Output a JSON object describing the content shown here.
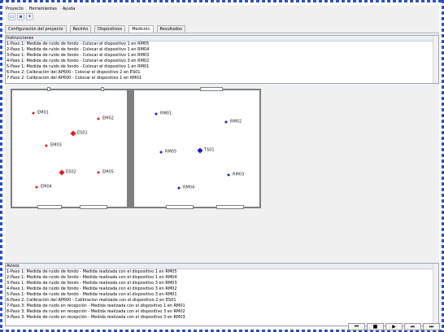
{
  "menu": [
    "Proyecto",
    "Herramientas",
    "Ayuda"
  ],
  "toolbar": {
    "icons": [
      "new-file-icon",
      "save-icon",
      "settings-icon"
    ],
    "symbols": [
      "▭",
      "▪",
      "✦"
    ]
  },
  "tabs": [
    "Configuración del proyecto",
    "Recinto",
    "Dispositivos",
    "Medición",
    "Resultados"
  ],
  "active_tab": "Medición",
  "instructions": {
    "title": "Instrucciones",
    "rows": [
      "1-Paso 1: Medida de ruido de fondo - Colocar el dispositivo 1 en RM05",
      "2-Paso 1: Medida de ruido de fondo - Colocar el dispositivo 1 en RM04",
      "3-Paso 1: Medida de ruido de fondo - Colocar el dispositivo 1 en RM03",
      "4-Paso 1: Medida de ruido de fondo - Colocar el dispositivo 3 en RM02",
      "5-Paso 1: Medida de ruido de fondo - Colocar el dispositivo 1 en RM01",
      "6-Paso 2: Calibración del AP600 - Colocar el dispositivo 2 en ES01",
      "7-Paso 2: Calibración del AP600 - Colocar el dispositivo 1 en RM01"
    ]
  },
  "floorplan": {
    "emission_points": [
      "EM01",
      "EM02",
      "ES01",
      "EM03",
      "ES02",
      "EM05",
      "EM04"
    ],
    "reception_points": [
      "RM01",
      "RM02",
      "RM05",
      "TS01",
      "RM03",
      "RM04"
    ],
    "colors": {
      "emission": "#e01b1b",
      "reception": "#1a1acf",
      "wall": "#7f7f7f"
    }
  },
  "notices": {
    "title": "Avisos",
    "rows": [
      "1-Paso 1: Medida de ruido de fondo - Medida realizada con el dispositivo 1 en RM05",
      "2-Paso 1: Medida de ruido de fondo - Medida realizada con el dispositivo 1 en RM04",
      "3-Paso 1: Medida de ruido de fondo - Medida realizada con el dispositivo 3 en RM03",
      "4-Paso 1: Medida de ruido de fondo - Medida realizada con el dispositivo 3 en RM02",
      "5-Paso 1: Medida de ruido de fondo - Medida realizada con el dispositivo 3 en RM01",
      "6-Paso 2: Calibración del AP600 - Calibracion realizada con el dispositivo 2 en ES01",
      "7-Paso 3: Medida de ruido en recepción - Medida realizada con el dispositivo 1 en RM01",
      "8-Paso 3: Medida de ruido en recepción - Medida realizada con el dispositivo 3 en RM02",
      "9-Paso 3: Medida de ruido en recepción - Medida realizada con el dispositivo 3 en RM03"
    ]
  },
  "nav": [
    "⏮",
    "■",
    "▶",
    "⏭",
    "⏭"
  ]
}
